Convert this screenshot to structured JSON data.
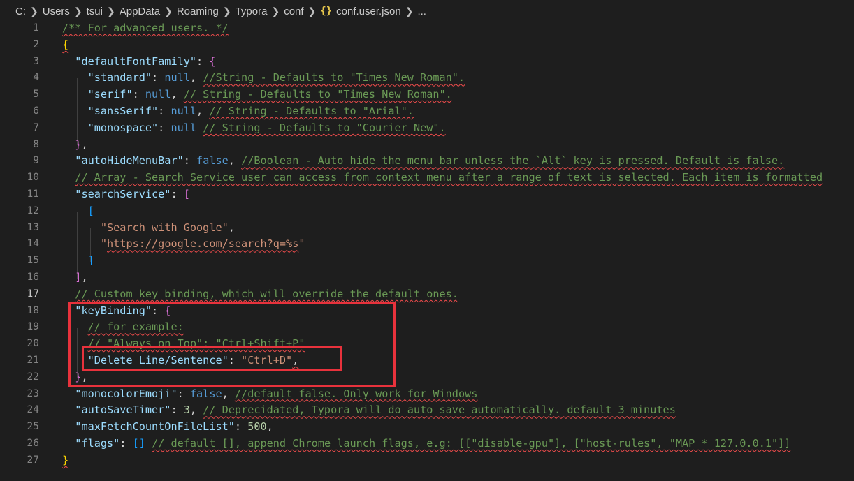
{
  "breadcrumb": {
    "items": [
      "C:",
      "Users",
      "tsui",
      "AppData",
      "Roaming",
      "Typora",
      "conf"
    ],
    "file_icon": "{}",
    "file": "conf.user.json",
    "more": "..."
  },
  "editor": {
    "active_line": 17,
    "line_numbers": [
      "1",
      "2",
      "3",
      "4",
      "5",
      "6",
      "7",
      "8",
      "9",
      "10",
      "11",
      "12",
      "13",
      "14",
      "15",
      "16",
      "17",
      "18",
      "19",
      "20",
      "21",
      "22",
      "23",
      "24",
      "25",
      "26",
      "27"
    ],
    "lines": [
      [
        {
          "t": "/** For advanced users. */",
          "c": "c",
          "sq": true
        }
      ],
      [
        {
          "t": "{",
          "c": "y",
          "sq": true
        }
      ],
      [
        {
          "t": "  "
        },
        {
          "t": "\"defaultFontFamily\"",
          "c": "k"
        },
        {
          "t": ": ",
          "c": "p"
        },
        {
          "t": "{",
          "c": "m"
        }
      ],
      [
        {
          "t": "    "
        },
        {
          "t": "\"standard\"",
          "c": "k"
        },
        {
          "t": ": ",
          "c": "p"
        },
        {
          "t": "null",
          "c": "b"
        },
        {
          "t": ", ",
          "c": "p"
        },
        {
          "t": "//String - Defaults to \"Times New Roman\".",
          "c": "c",
          "sq": true
        }
      ],
      [
        {
          "t": "    "
        },
        {
          "t": "\"serif\"",
          "c": "k"
        },
        {
          "t": ": ",
          "c": "p"
        },
        {
          "t": "null",
          "c": "b"
        },
        {
          "t": ", ",
          "c": "p"
        },
        {
          "t": "// String - Defaults to \"Times New Roman\".",
          "c": "c",
          "sq": true
        }
      ],
      [
        {
          "t": "    "
        },
        {
          "t": "\"sansSerif\"",
          "c": "k"
        },
        {
          "t": ": ",
          "c": "p"
        },
        {
          "t": "null",
          "c": "b"
        },
        {
          "t": ", ",
          "c": "p"
        },
        {
          "t": "// String - Defaults to \"Arial\".",
          "c": "c",
          "sq": true
        }
      ],
      [
        {
          "t": "    "
        },
        {
          "t": "\"monospace\"",
          "c": "k"
        },
        {
          "t": ": ",
          "c": "p"
        },
        {
          "t": "null",
          "c": "b"
        },
        {
          "t": " ",
          "c": "p"
        },
        {
          "t": "// String - Defaults to \"Courier New\".",
          "c": "c",
          "sq": true
        }
      ],
      [
        {
          "t": "  "
        },
        {
          "t": "}",
          "c": "m"
        },
        {
          "t": ",",
          "c": "p"
        }
      ],
      [
        {
          "t": "  "
        },
        {
          "t": "\"autoHideMenuBar\"",
          "c": "k"
        },
        {
          "t": ": ",
          "c": "p"
        },
        {
          "t": "false",
          "c": "b"
        },
        {
          "t": ", ",
          "c": "p"
        },
        {
          "t": "//Boolean - Auto hide the menu bar unless the `Alt` key is pressed. Default is false.",
          "c": "c",
          "sq": true
        }
      ],
      [
        {
          "t": "  "
        },
        {
          "t": "// Array - Search Service user can access from context menu after a range of text is selected. Each item is formatted",
          "c": "c",
          "sq": true
        }
      ],
      [
        {
          "t": "  "
        },
        {
          "t": "\"searchService\"",
          "c": "k"
        },
        {
          "t": ": ",
          "c": "p"
        },
        {
          "t": "[",
          "c": "m"
        }
      ],
      [
        {
          "t": "    "
        },
        {
          "t": "[",
          "c": "bl"
        }
      ],
      [
        {
          "t": "      "
        },
        {
          "t": "\"Search with Google\"",
          "c": "s"
        },
        {
          "t": ",",
          "c": "p"
        }
      ],
      [
        {
          "t": "      "
        },
        {
          "t": "\"",
          "c": "s"
        },
        {
          "t": "https://google.com/search?q=%s",
          "c": "s",
          "sq": true
        },
        {
          "t": "\"",
          "c": "s"
        }
      ],
      [
        {
          "t": "    "
        },
        {
          "t": "]",
          "c": "bl"
        }
      ],
      [
        {
          "t": "  "
        },
        {
          "t": "]",
          "c": "m"
        },
        {
          "t": ",",
          "c": "p"
        }
      ],
      [
        {
          "t": "  "
        },
        {
          "t": "// Custom key binding, which will override the default ones.",
          "c": "c",
          "sq": true
        }
      ],
      [
        {
          "t": "  "
        },
        {
          "t": "\"keyBinding\"",
          "c": "k"
        },
        {
          "t": ": ",
          "c": "p"
        },
        {
          "t": "{",
          "c": "m"
        }
      ],
      [
        {
          "t": "    "
        },
        {
          "t": "// for example:",
          "c": "c",
          "sq": true
        }
      ],
      [
        {
          "t": "    "
        },
        {
          "t": "// \"Always on Top\": \"Ctrl+Shift+P\"",
          "c": "c",
          "sq": true
        }
      ],
      [
        {
          "t": "    "
        },
        {
          "t": "\"Delete Line/Sentence\"",
          "c": "k"
        },
        {
          "t": ": ",
          "c": "p"
        },
        {
          "t": "\"Ctrl+D\"",
          "c": "s"
        },
        {
          "t": ",",
          "c": "p",
          "sq": true
        }
      ],
      [
        {
          "t": "  "
        },
        {
          "t": "}",
          "c": "m"
        },
        {
          "t": ",",
          "c": "p"
        }
      ],
      [
        {
          "t": "  "
        },
        {
          "t": "\"monocolorEmoji\"",
          "c": "k"
        },
        {
          "t": ": ",
          "c": "p"
        },
        {
          "t": "false",
          "c": "b"
        },
        {
          "t": ", ",
          "c": "p"
        },
        {
          "t": "//default false. Only work for Windows",
          "c": "c",
          "sq": true
        }
      ],
      [
        {
          "t": "  "
        },
        {
          "t": "\"autoSaveTimer\"",
          "c": "k"
        },
        {
          "t": ": ",
          "c": "p"
        },
        {
          "t": "3",
          "c": "n"
        },
        {
          "t": ", ",
          "c": "p"
        },
        {
          "t": "// Deprecidated, Typora will do auto save automatically. default 3 minutes",
          "c": "c",
          "sq": true
        }
      ],
      [
        {
          "t": "  "
        },
        {
          "t": "\"maxFetchCountOnFileList\"",
          "c": "k"
        },
        {
          "t": ": ",
          "c": "p"
        },
        {
          "t": "500",
          "c": "n"
        },
        {
          "t": ",",
          "c": "p"
        }
      ],
      [
        {
          "t": "  "
        },
        {
          "t": "\"flags\"",
          "c": "k"
        },
        {
          "t": ": ",
          "c": "p"
        },
        {
          "t": "[]",
          "c": "bl"
        },
        {
          "t": " ",
          "c": "p"
        },
        {
          "t": "// default [], append Chrome launch flags, e.g: [[\"disable-gpu\"], [\"host-rules\", \"MAP * 127.0.0.1\"]]",
          "c": "c",
          "sq": true
        }
      ],
      [
        {
          "t": "}",
          "c": "y",
          "sq": true
        }
      ]
    ]
  },
  "colors": {
    "background": "#1e1e1e",
    "key": "#9cdcfe",
    "string": "#ce9178",
    "comment": "#6a9955",
    "keyword": "#569cd6",
    "number": "#b5cea8",
    "highlight_box": "#e8323c"
  }
}
